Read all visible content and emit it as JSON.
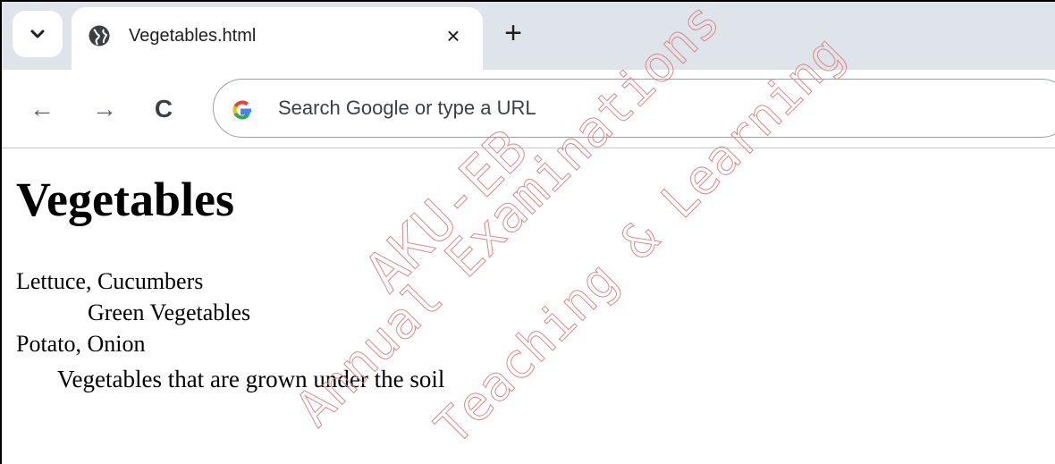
{
  "browser": {
    "tab": {
      "title": "Vegetables.html",
      "close_glyph": "×",
      "icon": "globe-icon"
    },
    "tab_search_icon": "chevron-down-icon",
    "new_tab_glyph": "+",
    "nav": {
      "back_glyph": "←",
      "forward_glyph": "→",
      "reload_glyph": "C"
    },
    "omnibox": {
      "logo_icon": "google-g-icon",
      "placeholder": "Search Google or type a URL"
    }
  },
  "page": {
    "heading": "Vegetables",
    "lines": [
      "Lettuce, Cucumbers",
      "Green Vegetables",
      "Potato, Onion",
      "Vegetables that are grown under the soil"
    ]
  },
  "watermark": {
    "lines": [
      "AKU-EB",
      "Annual Examinations",
      "Teaching & Learning"
    ],
    "color": "#d88a8a"
  }
}
